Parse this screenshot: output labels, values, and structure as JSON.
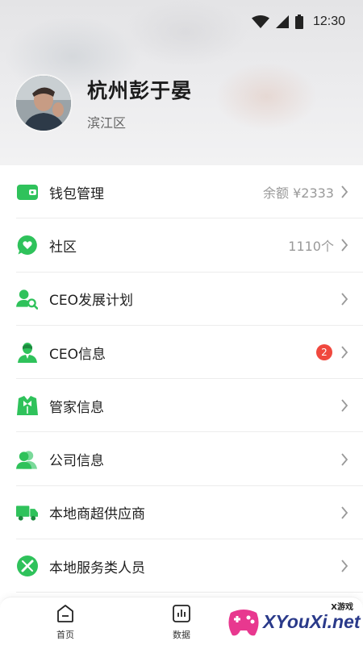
{
  "status_bar": {
    "time": "12:30"
  },
  "profile": {
    "name": "杭州彭于晏",
    "district": "滨江区"
  },
  "menu": [
    {
      "label": "钱包管理",
      "value": "余额 ¥2333",
      "icon": "wallet-icon"
    },
    {
      "label": "社区",
      "value": "1110个",
      "icon": "chat-bubble-icon"
    },
    {
      "label": "CEO发展计划",
      "value": "",
      "icon": "user-search-icon"
    },
    {
      "label": "CEO信息",
      "value": "",
      "badge": "2",
      "icon": "ceo-person-icon"
    },
    {
      "label": "管家信息",
      "value": "",
      "icon": "butler-icon"
    },
    {
      "label": "公司信息",
      "value": "",
      "icon": "people-icon"
    },
    {
      "label": "本地商超供应商",
      "value": "",
      "icon": "truck-icon"
    },
    {
      "label": "本地服务类人员",
      "value": "",
      "icon": "tools-icon"
    }
  ],
  "bottom_nav": [
    {
      "label": "首页",
      "icon": "home-icon"
    },
    {
      "label": "数据",
      "icon": "chart-icon"
    }
  ],
  "watermark": {
    "brand": "XYouXi.net",
    "tag": "X游戏"
  },
  "colors": {
    "accent_green": "#2fc25b",
    "badge_red": "#f0483e"
  }
}
